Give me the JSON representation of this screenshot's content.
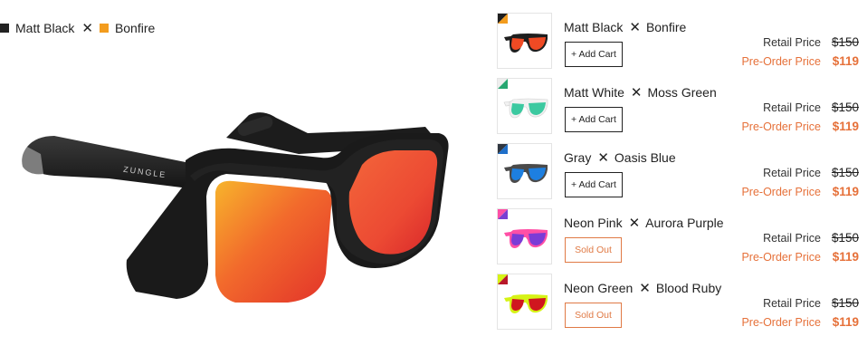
{
  "selected": {
    "frame": "Matt Black",
    "separator": "✕",
    "lens": "Bonfire",
    "frame_color": "#222222",
    "lens_color": "#f39c1e"
  },
  "hero": {
    "brand": "ZUNGLE"
  },
  "variants": [
    {
      "frame": "Matt Black",
      "lens": "Bonfire",
      "separator": "✕",
      "button": "+ Add Cart",
      "sold_out": false,
      "retail_label": "Retail Price",
      "retail_price": "$150",
      "preorder_label": "Pre-Order Price",
      "preorder_price": "$119",
      "frame_color": "#1e1e1e",
      "lens_color": "#ef4a24",
      "corner_a": "#1e1e1e",
      "corner_b": "#f39c1e"
    },
    {
      "frame": "Matt White",
      "lens": "Moss Green",
      "separator": "✕",
      "button": "+ Add Cart",
      "sold_out": false,
      "retail_label": "Retail Price",
      "retail_price": "$150",
      "preorder_label": "Pre-Order Price",
      "preorder_price": "$119",
      "frame_color": "#f1f1f1",
      "lens_color": "#3cc9a0",
      "corner_a": "#eeeeee",
      "corner_b": "#27a671"
    },
    {
      "frame": "Gray",
      "lens": "Oasis Blue",
      "separator": "✕",
      "button": "+ Add Cart",
      "sold_out": false,
      "retail_label": "Retail Price",
      "retail_price": "$150",
      "preorder_label": "Pre-Order Price",
      "preorder_price": "$119",
      "frame_color": "#4a4a4a",
      "lens_color": "#1d7fe0",
      "corner_a": "#2f3640",
      "corner_b": "#1f6fc9"
    },
    {
      "frame": "Neon Pink",
      "lens": "Aurora Purple",
      "separator": "✕",
      "button": "Sold Out",
      "sold_out": true,
      "retail_label": "Retail Price",
      "retail_price": "$150",
      "preorder_label": "Pre-Order Price",
      "preorder_price": "$119",
      "frame_color": "#ff4fa6",
      "lens_color": "#7b3cd6",
      "corner_a": "#ff4fa6",
      "corner_b": "#7a3fd2"
    },
    {
      "frame": "Neon Green",
      "lens": "Blood Ruby",
      "separator": "✕",
      "button": "Sold Out",
      "sold_out": true,
      "retail_label": "Retail Price",
      "retail_price": "$150",
      "preorder_label": "Pre-Order Price",
      "preorder_price": "$119",
      "frame_color": "#d6f316",
      "lens_color": "#d0161f",
      "corner_a": "#d6f316",
      "corner_b": "#b8182a"
    }
  ]
}
